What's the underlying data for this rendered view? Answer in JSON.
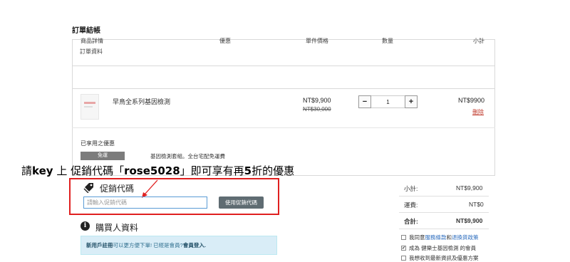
{
  "page": {
    "title": "訂單結帳"
  },
  "order": {
    "section_title": "訂單資料",
    "headers": {
      "product": "商品詳情",
      "discount": "優惠",
      "unit_price": "單件價格",
      "qty": "數量",
      "subtotal": "小計"
    },
    "item": {
      "name": "早鳥全系列基因檢測",
      "price": "NT$9,900",
      "original_price": "NT$30,000",
      "quantity": "1",
      "subtotal": "NT$9900",
      "delete_label": "刪除",
      "minus": "−",
      "plus": "+"
    },
    "applied": {
      "label": "已享用之優惠",
      "tag": "免運",
      "description": "基因檢測套組。全台宅配免運費"
    }
  },
  "annotation": {
    "pre": "請",
    "key": "key",
    "mid1": " 上 促銷代碼「",
    "code": "rose5028",
    "mid2": "」即可享有再",
    "num": "5",
    "post": "折的優惠"
  },
  "promo": {
    "title": "促銷代碼",
    "placeholder": "請輸入促銷代碼",
    "button": "使用促銷代碼"
  },
  "summary": {
    "subtotal_label": "小計:",
    "subtotal_value": "NT$9,900",
    "shipping_label": "運費:",
    "shipping_value": "NT$0",
    "total_label": "合計:",
    "total_value": "NT$9,900"
  },
  "buyer": {
    "title": "購買人資料",
    "notice_bold1": "新用戶註冊",
    "notice_text": "可以更方便下單! 已經是會員?",
    "notice_bold2": "會員登入."
  },
  "consents": [
    {
      "pre": "我同意",
      "link1": "服務條款",
      "mid": "和",
      "link2": "退換貨政策",
      "checked": false
    },
    {
      "text": "成為 健樂士基因檢測 的會員",
      "checked": true
    },
    {
      "text": "我想收到最新資訊及優惠方案",
      "checked": false
    }
  ],
  "colors": {
    "highlight_border": "#e02020",
    "link": "#2a6bbd",
    "delete": "#c0392b",
    "notice_bg": "#d9edf7"
  }
}
